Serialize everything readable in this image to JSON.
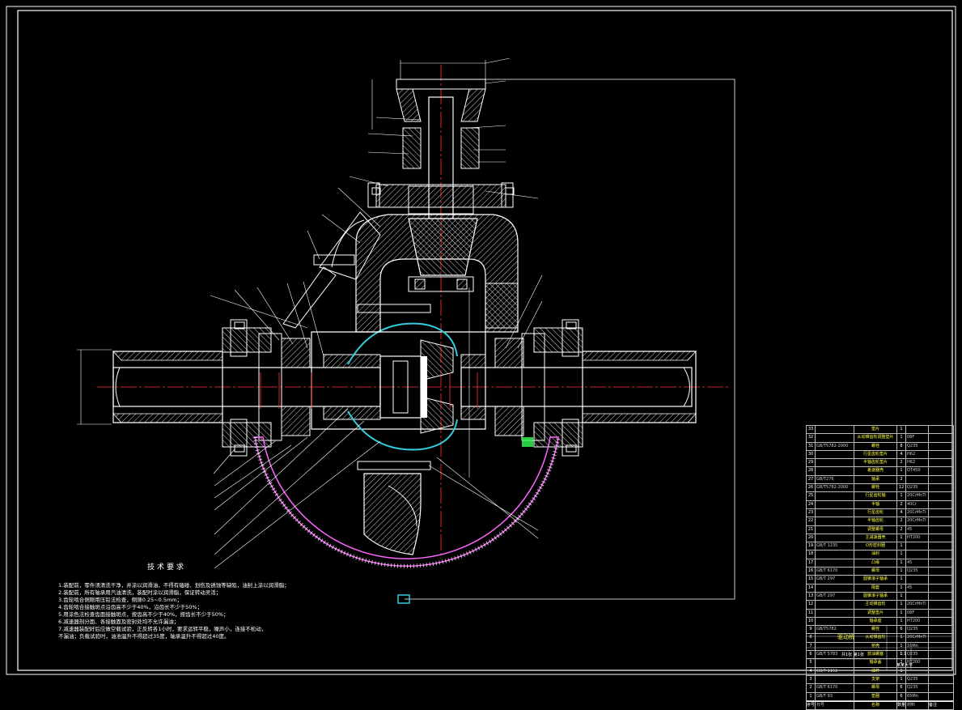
{
  "tech_requirements": {
    "title": "技术要求",
    "items": [
      "1.装配前，零件须清洗干净，并涂以润滑油，不得有磕碰、划伤及锈蚀等缺陷，油封上涂以润滑脂；",
      "2.装配前，所有轴承用汽油清洗，装配时涂以润滑脂，保证转动灵活；",
      "3.齿轮啮合侧隙用压铅法检查，侧隙0.25~0.5mm；",
      "4.齿轮啮合接触斑点沿齿高不少于40%，沿齿长不少于50%；",
      "5.用涂色法检查齿面接触斑点，按齿高不少于40%，按齿长不少于50%；",
      "6.减速器剖分面、各接触面及密封处均不允许漏油；",
      "7.减速器装配好后应做空载试验，正反转各1小时，要求运转平稳，噪声小，连接不松动，",
      "  不漏油；负载试验时，油池温升不得超过35度，轴承温升不得超过40度。"
    ]
  },
  "bom": {
    "rows": [
      [
        "33",
        "",
        "垫片",
        "1",
        "",
        ""
      ],
      [
        "32",
        "",
        "从动锥齿轮调整垫片",
        "1",
        "08F",
        ""
      ],
      [
        "31",
        "GB/T5782-2000",
        "螺栓",
        "8",
        "Q235",
        ""
      ],
      [
        "30",
        "",
        "行星齿轮垫片",
        "4",
        "H62",
        ""
      ],
      [
        "29",
        "",
        "半轴齿轮垫片",
        "2",
        "H62",
        ""
      ],
      [
        "28",
        "",
        "差速器壳",
        "1",
        "QT450",
        ""
      ],
      [
        "27",
        "GB/T276",
        "轴承",
        "2",
        "",
        ""
      ],
      [
        "26",
        "GB/T5782-2000",
        "螺栓",
        "12",
        "Q235",
        ""
      ],
      [
        "25",
        "",
        "行星齿轮轴",
        "1",
        "20CrMnTi",
        ""
      ],
      [
        "24",
        "",
        "半轴",
        "2",
        "40Cr",
        ""
      ],
      [
        "23",
        "",
        "行星齿轮",
        "4",
        "20CrMnTi",
        ""
      ],
      [
        "22",
        "",
        "半轴齿轮",
        "2",
        "20CrMnTi",
        ""
      ],
      [
        "21",
        "",
        "调整螺母",
        "2",
        "45",
        ""
      ],
      [
        "20",
        "",
        "主减速器壳",
        "1",
        "HT200",
        ""
      ],
      [
        "19",
        "GB/T 1235",
        "O形密封圈",
        "1",
        "",
        ""
      ],
      [
        "18",
        "",
        "油封",
        "1",
        "",
        ""
      ],
      [
        "17",
        "",
        "凸缘",
        "1",
        "45",
        ""
      ],
      [
        "16",
        "GB/T 6170",
        "螺母",
        "1",
        "Q235",
        ""
      ],
      [
        "15",
        "GB/T 297",
        "圆锥滚子轴承",
        "1",
        "",
        ""
      ],
      [
        "14",
        "",
        "隔套",
        "1",
        "45",
        ""
      ],
      [
        "13",
        "GB/T 297",
        "圆锥滚子轴承",
        "1",
        "",
        ""
      ],
      [
        "12",
        "",
        "主动锥齿轮",
        "1",
        "20CrMnTi",
        ""
      ],
      [
        "11",
        "",
        "调整垫片",
        "1",
        "08F",
        ""
      ],
      [
        "10",
        "",
        "轴承座",
        "1",
        "HT200",
        ""
      ],
      [
        "9",
        "GB/T5782",
        "螺栓",
        "6",
        "Q235",
        ""
      ],
      [
        "8",
        "",
        "从动锥齿轮",
        "1",
        "20CrMnTi",
        ""
      ],
      [
        "7",
        "",
        "桥壳",
        "1",
        "16Mn",
        ""
      ],
      [
        "6",
        "GB/T 5783",
        "放油螺塞",
        "1",
        "Q235",
        ""
      ],
      [
        "5",
        "",
        "轴承盖",
        "2",
        "HT200",
        ""
      ],
      [
        "4",
        "GB/T 1152",
        "油杯",
        "1",
        "",
        ""
      ],
      [
        "3",
        "",
        "支架",
        "1",
        "Q235",
        ""
      ],
      [
        "2",
        "GB/T 6170",
        "螺母",
        "6",
        "Q235",
        ""
      ],
      [
        "1",
        "GB/T 93",
        "垫圈",
        "6",
        "65Mn",
        ""
      ]
    ],
    "header": [
      "序号",
      "代号",
      "名称",
      "数量",
      "材料",
      "备注"
    ]
  },
  "title_block": {
    "drawing_name": "驱动桥",
    "school": "某某大学",
    "scale": "1:1",
    "sheet": "共1张 第1张"
  },
  "colors": {
    "outline": "#ffffff",
    "centerline": "#ff3333",
    "hatch": "#ffffff",
    "cyan": "#33ccdd",
    "housing": "#ff66ff",
    "leader": "#ffffff",
    "annot": "#ffff44",
    "green": "#33ff55"
  }
}
